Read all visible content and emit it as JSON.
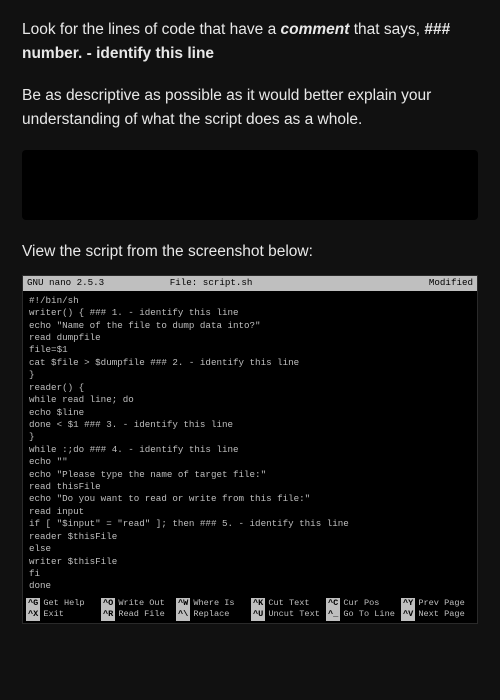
{
  "instructions": {
    "l1a": "Look for the lines of code that have a ",
    "l1b": "comment",
    "l1c": " that says, ",
    "l1d": "### number. - identify this line",
    "p2": "Be as descriptive as possible as it would better explain your understanding of what the script does as a whole.",
    "caption": "View the script from the screenshot below:"
  },
  "terminal": {
    "app": "GNU nano 2.5.3",
    "file_label": "File: script.sh",
    "status": "Modified",
    "lines": [
      "#!/bin/sh",
      "",
      "writer() { ### 1. - identify this line",
      "echo \"Name of the file to dump data into?\"",
      "read dumpfile",
      "file=$1",
      "cat $file > $dumpfile ### 2. - identify this line",
      "}",
      "reader() {",
      "while read line; do",
      "echo $line",
      "done < $1 ### 3. - identify this line",
      "}",
      "while :;do ### 4. - identify this line",
      "echo \"\"",
      "echo \"Please type the name of target file:\"",
      "read thisFile",
      "echo \"Do you want to read or write from this file:\"",
      "read input",
      "if [ \"$input\" = \"read\" ]; then ### 5. - identify this line",
      "reader $thisFile",
      "else",
      "writer $thisFile",
      "fi",
      "done"
    ],
    "footer": [
      {
        "key": "^G",
        "label": "Get Help"
      },
      {
        "key": "^O",
        "label": "Write Out"
      },
      {
        "key": "^W",
        "label": "Where Is"
      },
      {
        "key": "^K",
        "label": "Cut Text"
      },
      {
        "key": "^C",
        "label": "Cur Pos"
      },
      {
        "key": "^Y",
        "label": "Prev Page"
      },
      {
        "key": "^X",
        "label": "Exit"
      },
      {
        "key": "^R",
        "label": "Read File"
      },
      {
        "key": "^\\",
        "label": "Replace"
      },
      {
        "key": "^U",
        "label": "Uncut Text"
      },
      {
        "key": "^_",
        "label": "Go To Line"
      },
      {
        "key": "^V",
        "label": "Next Page"
      }
    ]
  }
}
